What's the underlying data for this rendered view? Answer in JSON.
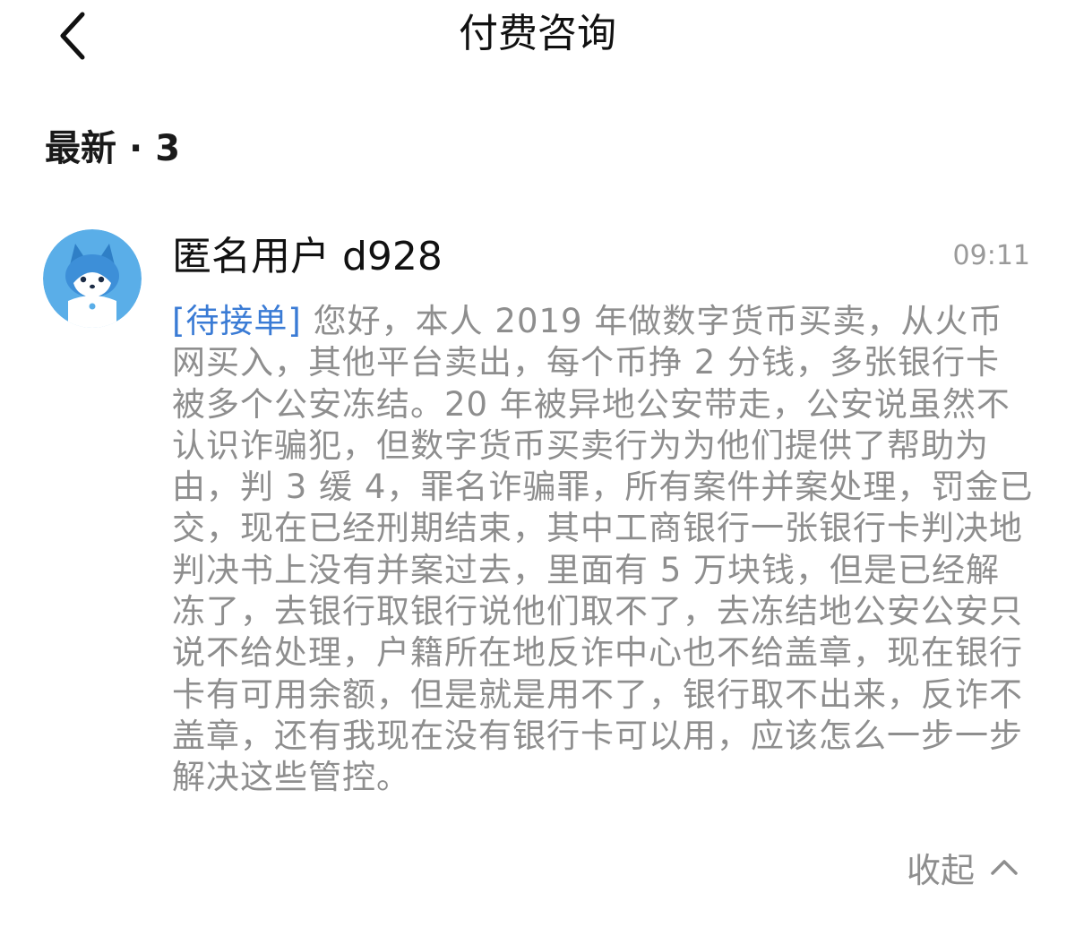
{
  "header": {
    "title": "付费咨询",
    "back_icon": "chevron-left-icon"
  },
  "section": {
    "label": "最新",
    "separator": "·",
    "count": "3"
  },
  "post": {
    "avatar_icon": "husky-dog-avatar",
    "username": "匿名用户 d928",
    "timestamp": "09:11",
    "status_tag": "[待接单]",
    "message": " 您好，本人 2019 年做数字货币买卖，从火币网买入，其他平台卖出，每个币挣 2 分钱，多张银行卡被多个公安冻结。20 年被异地公安带走，公安说虽然不认识诈骗犯，但数字货币买卖行为为他们提供了帮助为由，判 3 缓 4，罪名诈骗罪，所有案件并案处理，罚金已交，现在已经刑期结束，其中工商银行一张银行卡判决地判决书上没有并案过去，里面有 5 万块钱，但是已经解冻了，去银行取银行说他们取不了，去冻结地公安公安只说不给处理，户籍所在地反诈中心也不给盖章，现在银行卡有可用余额，但是就是用不了，银行取不出来，反诈不盖章，还有我现在没有银行卡可以用，应该怎么一步一步解决这些管控。",
    "collapse_label": "收起",
    "collapse_icon": "chevron-up-icon"
  },
  "colors": {
    "status_tag": "#3a7bd5",
    "body_text": "#8e8e8e",
    "title_text": "#111111",
    "avatar_bg": "#5aaee8"
  }
}
